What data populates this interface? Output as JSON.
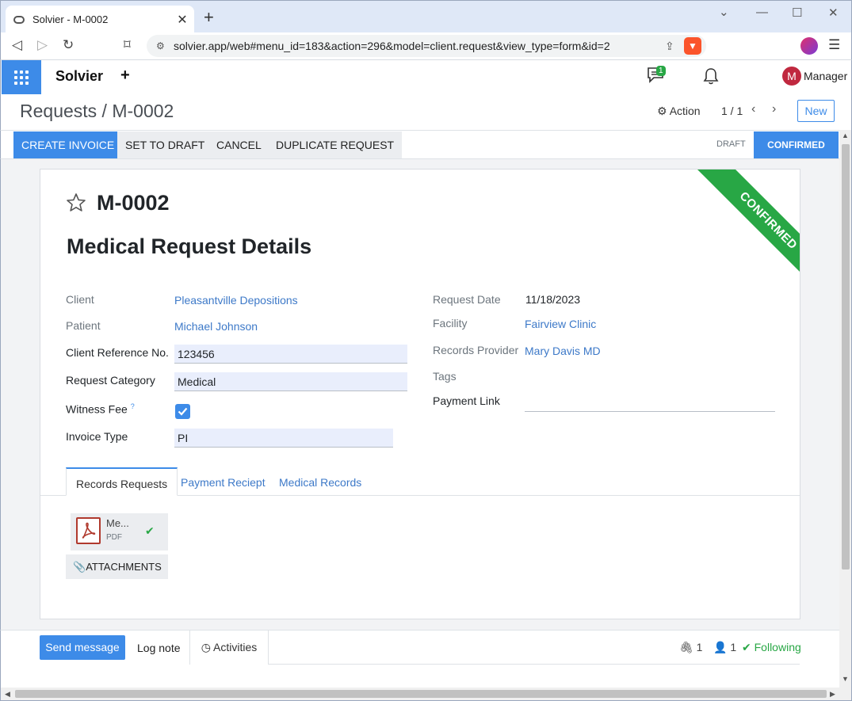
{
  "browser": {
    "tab_title": "Solvier - M-0002",
    "url": "solvier.app/web#menu_id=183&action=296&model=client.request&view_type=form&id=2",
    "new_tab": "+",
    "tab_close": "✕",
    "minimize": "—",
    "restore": "☐",
    "close": "✕"
  },
  "navbar": {
    "brand": "Solvier",
    "plus": "+",
    "chat_badge": "1",
    "user_initial": "M",
    "user_name": "Manager"
  },
  "control_panel": {
    "breadcrumb": "Requests / M-0002",
    "action_label": "Action",
    "pager": "1 / 1",
    "new_label": "New"
  },
  "statusbar": {
    "buttons": [
      "CREATE INVOICE",
      "SET TO DRAFT",
      "CANCEL",
      "DUPLICATE REQUEST"
    ],
    "stages": [
      "DRAFT",
      "CONFIRMED"
    ],
    "active_stage": "CONFIRMED"
  },
  "form": {
    "ribbon": "CONFIRMED",
    "record_name": "M-0002",
    "title": "Medical Request Details",
    "left": {
      "client_label": "Client",
      "client_value": "Pleasantville Depositions",
      "patient_label": "Patient",
      "patient_value": "Michael Johnson",
      "client_ref_label": "Client Reference No.",
      "client_ref_value": "123456",
      "category_label": "Request Category",
      "category_value": "Medical",
      "witness_fee_label": "Witness Fee",
      "witness_fee_help": "?",
      "witness_fee_checked": true,
      "invoice_type_label": "Invoice Type",
      "invoice_type_value": "PI"
    },
    "right": {
      "request_date_label": "Request Date",
      "request_date_value": "11/18/2023",
      "facility_label": "Facility",
      "facility_value": "Fairview Clinic",
      "records_provider_label": "Records Provider",
      "records_provider_value": "Mary Davis MD",
      "tags_label": "Tags",
      "payment_link_label": "Payment Link"
    },
    "tabs": [
      "Records Requests",
      "Payment Reciept",
      "Medical Records"
    ],
    "active_tab": "Records Requests",
    "attachment": {
      "name": "Me...",
      "type": "PDF"
    },
    "attachments_button": "ATTACHMENTS"
  },
  "chatter": {
    "send_message": "Send message",
    "log_note": "Log note",
    "activities": "Activities",
    "attachments_count": "1",
    "followers_count": "1",
    "following": "Following"
  },
  "colors": {
    "primary": "#3d8be8",
    "success": "#28a745",
    "link": "#3d79c8"
  }
}
